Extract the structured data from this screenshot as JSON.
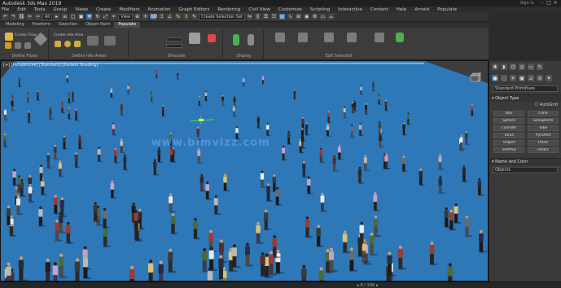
{
  "app": {
    "title": "Autodesk 3ds Max 2019",
    "right_text": "Sign In"
  },
  "menu": [
    "File",
    "Edit",
    "Tools",
    "Group",
    "Views",
    "Create",
    "Modifiers",
    "Animation",
    "Graph Editors",
    "Rendering",
    "Civil View",
    "Customize",
    "Scripting",
    "Interactive",
    "Content",
    "Help",
    "Arnold",
    "Populate"
  ],
  "toolbar": {
    "selection_filter": "All",
    "view_dropdown": "View",
    "selection_set": "Create Selection Set"
  },
  "ribbon": {
    "tabs": [
      "Modeling",
      "Freeform",
      "Selection",
      "Object Paint",
      "Populate"
    ],
    "active_tab": "Populate",
    "groups": {
      "define_flows": "Define Flows",
      "define_idle_areas": "Define Idle Areas",
      "simulate": "Simulate",
      "display": "Display",
      "edit_selected": "Edit Selected"
    },
    "buttons": {
      "create_flow": "Create Flow",
      "create_flow_sub": "Create Flow Preview",
      "create_idle_area": "Create Idle Area",
      "simulate": "Simulate",
      "display_people": "Display",
      "regenerate": "Regenerate",
      "randomize": "Randomize",
      "delete": "Delete",
      "generate": "Generate"
    }
  },
  "viewport": {
    "label": "[+] [Perspective] [Standard] [Default Shading]",
    "watermark": "www.bimvizz.com"
  },
  "command_panel": {
    "tabs": [
      "create",
      "modify",
      "hierarchy",
      "motion",
      "display",
      "utilities"
    ],
    "standard_primitives": "Standard Primitives",
    "object_type": "Object Type",
    "autogrid": "AutoGrid",
    "buttons": [
      "Box",
      "Cone",
      "Sphere",
      "GeoSphere",
      "Cylinder",
      "Tube",
      "Torus",
      "Pyramid",
      "Teapot",
      "Plane",
      "TextPlus",
      "Hedra"
    ],
    "name_and_color": "Name and Color",
    "name_value": "Objects"
  },
  "statusbar": {
    "nav_text": "0 / 100"
  }
}
